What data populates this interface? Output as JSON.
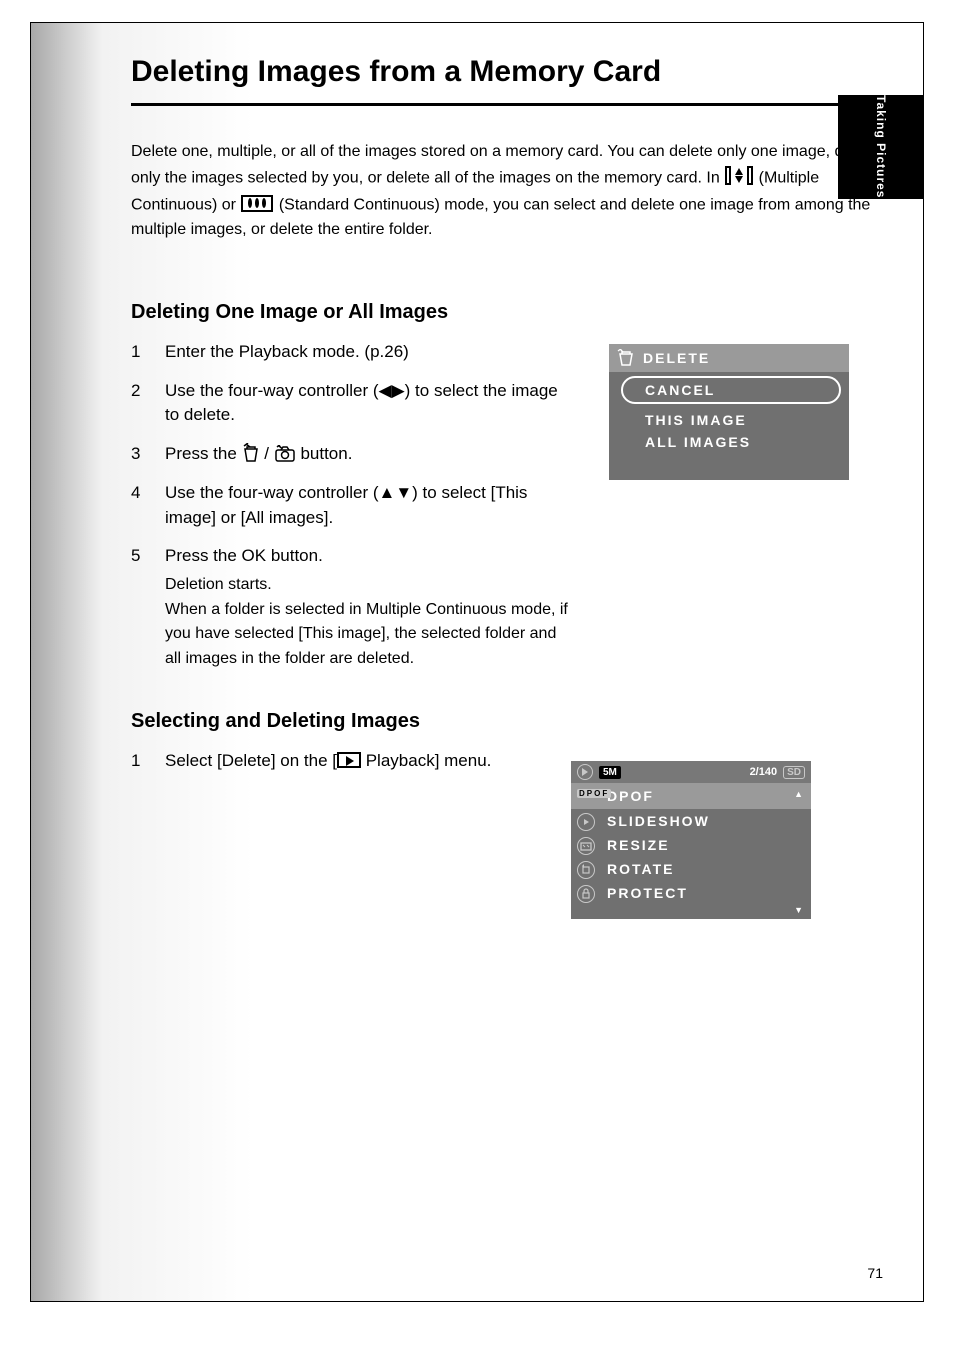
{
  "side_tab": "Taking Pictures",
  "page_number": "71",
  "h1": "Deleting Images from a Memory Card",
  "intro_part1": "Delete one, multiple, or all of the images stored on a memory card. You can delete only one image, delete only the images selected by you, or delete all of the images on the memory card. In ",
  "intro_part2": " (Multiple Continuous) or ",
  "intro_part3": " (Standard Continuous) mode, you can select and delete one image from among the multiple images, or delete the entire folder.",
  "h2a": "Deleting One Image or All Images",
  "steps_a": [
    "Enter the Playback mode.",
    "Use the four-way controller (◀▶) to select the image to delete.",
    "Press the 🗑 / 📷 button.",
    "Use the four-way controller (▲▼) to select [This image] or [All images].",
    "Press the OK button."
  ],
  "steps_a_extra": "(p.26)",
  "steps_a_cont": "Deletion starts.\nWhen a folder is selected in Multiple Continuous mode, if you have selected [This image], the selected folder and all images in the folder are deleted.",
  "delete_panel": {
    "title": "DELETE",
    "options": [
      "CANCEL",
      "THIS IMAGE",
      "ALL IMAGES"
    ]
  },
  "h2b": "Selecting and Deleting Images",
  "steps_b_1": "Select [Delete] on the [",
  "steps_b_1b": " Playback] menu.",
  "playback_menu": {
    "top_badge_5m": "5M",
    "top_count": "2/140",
    "top_sd": "SD",
    "items": [
      "DPOF",
      "SLIDESHOW",
      "RESIZE",
      "ROTATE",
      "PROTECT"
    ]
  }
}
